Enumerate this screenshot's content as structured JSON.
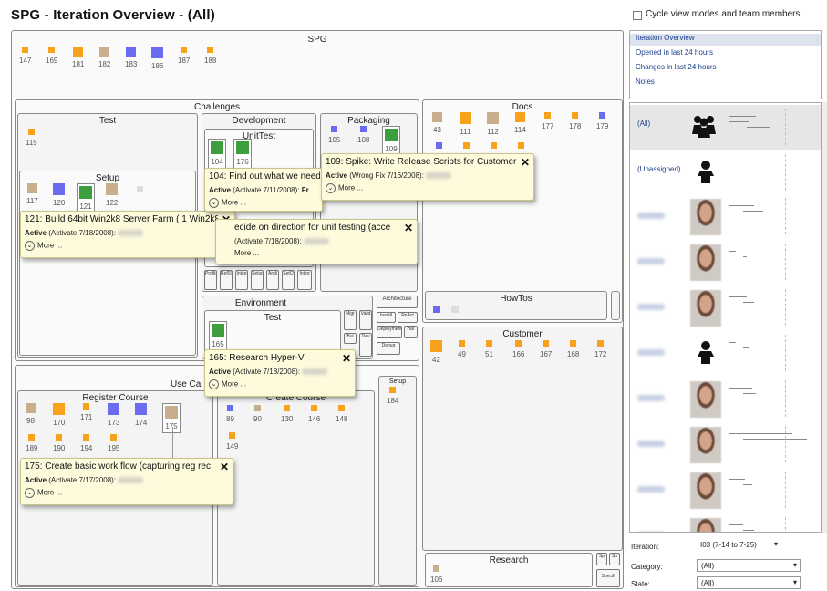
{
  "header": {
    "title": "SPG - Iteration Overview - (All)"
  },
  "colors": {
    "orange": "#f7a21b",
    "tan": "#c9ae8c",
    "blue": "#6b6bf0",
    "green": "#3c9e3c",
    "gray": "#dcdcdc"
  },
  "root": {
    "label": "SPG",
    "items": [
      {
        "id": "147",
        "c": "orange"
      },
      {
        "id": "169",
        "c": "orange"
      },
      {
        "id": "181",
        "c": "orange"
      },
      {
        "id": "182",
        "c": "tan"
      },
      {
        "id": "183",
        "c": "blue"
      },
      {
        "id": "186",
        "c": "blue"
      },
      {
        "id": "187",
        "c": "orange"
      },
      {
        "id": "188",
        "c": "orange"
      }
    ]
  },
  "areas": {
    "challenges": "Challenges",
    "test": "Test",
    "setup": "Setup",
    "development": "Development",
    "unittest": "UnitTest",
    "packaging": "Packaging",
    "docs": "Docs",
    "howtos": "HowTos",
    "environment": "Environment",
    "env_test": "Test",
    "customer": "Customer",
    "use_cases": "Use Ca",
    "register_course": "Register Course",
    "create_course": "Create Course",
    "setup2": "Setup",
    "research": "Research"
  },
  "test_items": [
    "115"
  ],
  "setup_items": [
    "117",
    "120",
    "121",
    "122"
  ],
  "unittest_items": [
    "104",
    "176"
  ],
  "packaging_items": [
    "105",
    "108",
    "109"
  ],
  "docs_items": [
    "43",
    "111",
    "112",
    "114",
    "177",
    "178",
    "179"
  ],
  "env_test_items": [
    "165"
  ],
  "customer_items": [
    "42",
    "49",
    "51",
    "166",
    "167",
    "168",
    "172"
  ],
  "register_items_row1": [
    "98",
    "170",
    "171",
    "173",
    "174",
    "175"
  ],
  "register_items_row2": [
    "189",
    "190",
    "194",
    "195"
  ],
  "create_items": [
    "89",
    "90",
    "130",
    "146",
    "148",
    "149"
  ],
  "setup2_items": [
    "184"
  ],
  "research_items": [
    "106"
  ],
  "mini": {
    "dev1": "Profile",
    "dev2": "Ref01",
    "dev3": "Integ",
    "dev4": "Setup",
    "dev5": "Andi",
    "dev6": "SetO",
    "dev7": "Integ",
    "arch": "Architecture",
    "env_a": "Migr",
    "env_b": "Valid",
    "env_c": "Bui",
    "env_d": "Dev",
    "env_e": "Install",
    "env_f": "ReAct",
    "env_g": "Deployment",
    "env_h": "Har",
    "env_i": "Debug",
    "res_a": "Sp",
    "res_b": "Sp",
    "res_c": "Specifi"
  },
  "popups": {
    "p121": {
      "title": "121: Build 64bit Win2k8 Server Farm ( 1 Win2k8",
      "state": "Active",
      "detail": "(Activate 7/18/2008):",
      "more": "More ..."
    },
    "p104": {
      "title": "104: Find out what we need",
      "state": "Active",
      "detail": "(Activate 7/11/2008):",
      "extra": "Fr",
      "more": "More ..."
    },
    "p109": {
      "title": "109: Spike: Write Release Scripts for Customer",
      "state": "Active",
      "detail": "(Wrong Fix 7/16/2008):",
      "more": "More ..."
    },
    "pdecide": {
      "title": "ecide on direction for unit testing (acce",
      "state": "",
      "detail": "(Activate 7/18/2008):",
      "more": "More ..."
    },
    "p165": {
      "title": "165: Research Hyper-V",
      "state": "Active",
      "detail": "(Activate 7/18/2008):",
      "more": "More ..."
    },
    "p175": {
      "title": "175: Create basic work flow (capturing reg rec",
      "state": "Active",
      "detail": "(Activate 7/17/2008):",
      "more": "More ..."
    }
  },
  "right_panel": {
    "cycle_label": "Cycle view modes and team members",
    "views": [
      "Iteration Overview",
      "Opened in last 24 hours",
      "Changes in last 24 hours",
      "Notes"
    ],
    "members": [
      "(All)",
      "(Unassigned)"
    ],
    "iteration_label": "Iteration:",
    "iteration_value": "I03 (7-14 to 7-25)",
    "category_label": "Category:",
    "category_value": "(All)",
    "state_label": "State:",
    "state_value": "(All)"
  }
}
